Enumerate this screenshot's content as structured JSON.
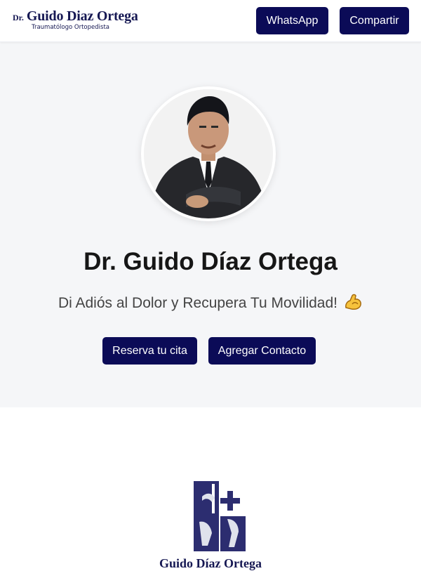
{
  "header": {
    "brand_prefix": "Dr.",
    "brand_name": "Guido Diaz Ortega",
    "brand_subtitle": "Traumatólogo Ortopedista",
    "whatsapp_label": "WhatsApp",
    "share_label": "Compartir"
  },
  "hero": {
    "title": "Dr. Guido Díaz Ortega",
    "subtitle": "Di Adiós al Dolor y Recupera Tu Movilidad!",
    "book_label": "Reserva tu cita",
    "contact_label": "Agregar Contacto"
  },
  "footer_partial_text": "Guido Díaz Ortega",
  "colors": {
    "accent": "#0b0b57",
    "brand_text": "#161853",
    "hero_bg": "#f5f6f8"
  },
  "icons": {
    "profile_photo": "doctor-portrait",
    "emoji": "flexed-biceps-icon",
    "logo": "orthopedic-logo-icon"
  }
}
